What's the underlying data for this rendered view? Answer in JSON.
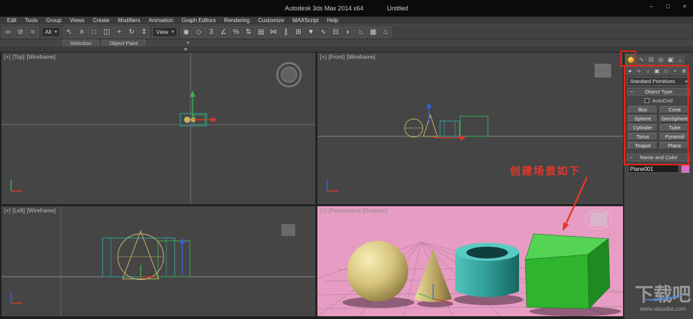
{
  "window": {
    "product_title": "Autodesk 3ds Max  2014 x64",
    "document_title": "Untitled",
    "minimize_glyph": "–",
    "maximize_glyph": "□",
    "close_glyph": "×"
  },
  "menu": {
    "items": [
      "Edit",
      "Tools",
      "Group",
      "Views",
      "Create",
      "Modifiers",
      "Animation",
      "Graph Editors",
      "Rendering",
      "Customize",
      "MAXScript",
      "Help"
    ]
  },
  "toolbar": {
    "filter_dropdown": "All",
    "coord_dropdown": "View",
    "icons_a": [
      {
        "name": "select-and-link-icon",
        "glyph": "∞"
      },
      {
        "name": "unlink-selection-icon",
        "glyph": "⊘"
      },
      {
        "name": "bind-to-space-warp-icon",
        "glyph": "≈"
      }
    ],
    "icons_b": [
      {
        "name": "select-object-icon",
        "glyph": "↖"
      },
      {
        "name": "select-by-name-icon",
        "glyph": "≡"
      },
      {
        "name": "rectangular-selection-icon",
        "glyph": "□"
      },
      {
        "name": "window-crossing-icon",
        "glyph": "◫"
      },
      {
        "name": "select-move-icon",
        "glyph": "+"
      },
      {
        "name": "select-rotate-icon",
        "glyph": "↻"
      },
      {
        "name": "select-scale-icon",
        "glyph": "⇕"
      }
    ],
    "icons_c": [
      {
        "name": "use-pivot-center-icon",
        "glyph": "◉"
      },
      {
        "name": "select-manipulate-icon",
        "glyph": "◇"
      },
      {
        "name": "snaps-toggle-icon",
        "glyph": "3"
      },
      {
        "name": "angle-snap-icon",
        "glyph": "∠"
      },
      {
        "name": "percent-snap-icon",
        "glyph": "%"
      },
      {
        "name": "spinner-snap-icon",
        "glyph": "⇅"
      },
      {
        "name": "edit-named-selection-icon",
        "glyph": "▤"
      },
      {
        "name": "mirror-icon",
        "glyph": "⋈"
      },
      {
        "name": "align-icon",
        "glyph": "∥"
      },
      {
        "name": "layer-manager-icon",
        "glyph": "⊞"
      },
      {
        "name": "graphite-toolbar-icon",
        "glyph": "▼"
      },
      {
        "name": "curve-editor-icon",
        "glyph": "∿"
      },
      {
        "name": "schematic-view-icon",
        "glyph": "⊟"
      },
      {
        "name": "material-editor-icon",
        "glyph": "◐"
      },
      {
        "name": "render-setup-icon",
        "glyph": "♨"
      },
      {
        "name": "rendered-frame-window-icon",
        "glyph": "▦"
      },
      {
        "name": "render-production-icon",
        "glyph": "♨"
      }
    ]
  },
  "ribbon": {
    "tabs": [
      "Selection",
      "Object Paint"
    ]
  },
  "viewports": {
    "top_left": {
      "menu": "[+]",
      "view": "[Top]",
      "shading": "[Wireframe]"
    },
    "top_right": {
      "menu": "[+]",
      "view": "[Front]",
      "shading": "[Wireframe]"
    },
    "bottom_left": {
      "menu": "[+]",
      "view": "[Left]",
      "shading": "[Wireframe]"
    },
    "bottom_right": {
      "menu": "[+]",
      "view": "[Perspective]",
      "shading": "[Realistic]"
    }
  },
  "command_panel": {
    "panel_tabs": [
      {
        "name": "modify-tab-icon",
        "glyph": "∿"
      },
      {
        "name": "hierarchy-tab-icon",
        "glyph": "⊟"
      },
      {
        "name": "motion-tab-icon",
        "glyph": "◎"
      },
      {
        "name": "display-tab-icon",
        "glyph": "▣"
      },
      {
        "name": "utilities-tab-icon",
        "glyph": "⌂"
      }
    ],
    "panel_categories": [
      {
        "name": "geometry-category-icon",
        "glyph": "●"
      },
      {
        "name": "shapes-category-icon",
        "glyph": "∿"
      },
      {
        "name": "lights-category-icon",
        "glyph": "☼"
      },
      {
        "name": "cameras-category-icon",
        "glyph": "▣"
      },
      {
        "name": "helpers-category-icon",
        "glyph": "◇"
      },
      {
        "name": "space-warps-category-icon",
        "glyph": "≈"
      },
      {
        "name": "systems-category-icon",
        "glyph": "⊕"
      }
    ],
    "dropdown_value": "Standard Primitives",
    "rollout_object_type": "Object Type",
    "autogrid_label": "AutoGrid",
    "object_buttons": [
      "Box",
      "Cone",
      "Sphere",
      "GeoSphere",
      "Cylinder",
      "Tube",
      "Torus",
      "Pyramid",
      "Teapot",
      "Plane"
    ],
    "rollout_name_color": "Name and Color",
    "object_name": "Plane001"
  },
  "annotation": {
    "text": "创建场景如下"
  },
  "watermark": {
    "title": "下载吧",
    "url": "www.xiazaiba.com"
  },
  "ui": {
    "caret": "▾",
    "collapse": "−"
  },
  "colors": {
    "highlight_red": "#ec2218",
    "viewport_background": "#454545",
    "perspective_background": "#e69cc3",
    "sphere_yellow": "#d6c47c",
    "tube_teal": "#2fa8a4",
    "box_green": "#2eb42e",
    "wireframe_yellow": "#cdb867",
    "axis_x_red": "#d43a2a",
    "axis_y_green": "#3cb054",
    "axis_z_blue": "#3a5fd9",
    "object_color_swatch": "#e06ac8"
  }
}
